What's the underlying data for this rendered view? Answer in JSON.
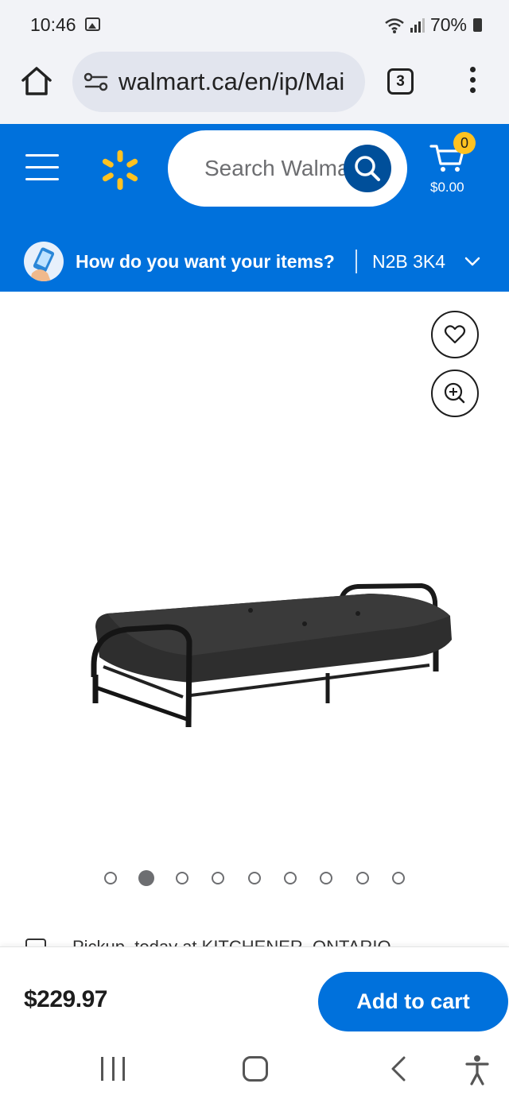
{
  "status_bar": {
    "time": "10:46",
    "battery": "70%",
    "icons": [
      "gallery-icon",
      "wifi-icon",
      "signal-icon",
      "battery-icon"
    ]
  },
  "browser": {
    "url": "walmart.ca/en/ip/Mai",
    "tab_count": "3"
  },
  "header": {
    "search_placeholder": "Search Walmart",
    "cart_count": "0",
    "cart_total": "$0.00",
    "fulfillment_question": "How do you want your items?",
    "postal_code": "N2B 3K4"
  },
  "gallery": {
    "image_count": 9,
    "active_index": 1
  },
  "pickup": {
    "text": "Pickup, today at KITCHENER, ONTARIO"
  },
  "purchase": {
    "price": "$229.97",
    "add_to_cart_label": "Add to cart"
  },
  "colors": {
    "brand_blue": "#0071dc",
    "brand_dark_blue": "#004f9a",
    "spark_yellow": "#ffc220"
  }
}
